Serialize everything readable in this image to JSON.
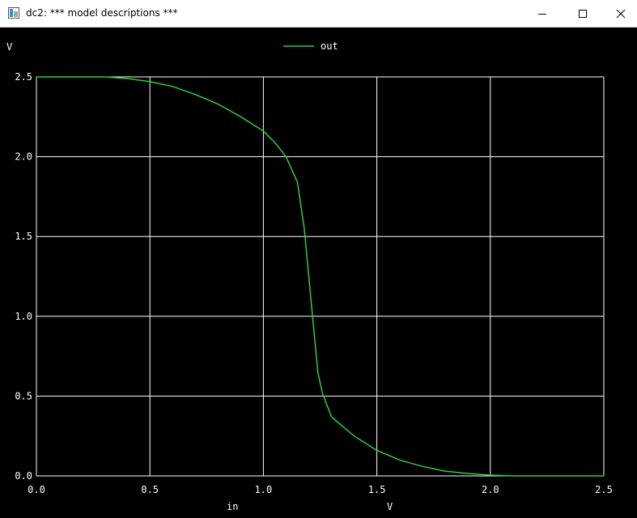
{
  "window": {
    "title": "dc2: *** model descriptions ***",
    "icons": {
      "app": "plot-window-icon",
      "minimize": "minimize-icon",
      "maximize": "maximize-icon",
      "close": "close-icon"
    }
  },
  "chart_data": {
    "type": "line",
    "title": "",
    "xlabel": "in",
    "xunit": "V",
    "ylabel": "",
    "yunit": "V",
    "xlim": [
      0,
      2.5
    ],
    "ylim": [
      0,
      2.5
    ],
    "xticks": [
      "0.0",
      "0.5",
      "1.0",
      "1.5",
      "2.0",
      "2.5"
    ],
    "yticks": [
      "0.0",
      "0.5",
      "1.0",
      "1.5",
      "2.0",
      "2.5"
    ],
    "grid": true,
    "legend": "top-center",
    "background": "#000000",
    "grid_color": "#ffffff",
    "series": [
      {
        "name": "out",
        "color": "#2ecc40",
        "x": [
          0.0,
          0.3,
          0.4,
          0.5,
          0.6,
          0.7,
          0.8,
          0.9,
          1.0,
          1.05,
          1.1,
          1.15,
          1.18,
          1.2,
          1.22,
          1.24,
          1.26,
          1.3,
          1.35,
          1.4,
          1.5,
          1.6,
          1.7,
          1.8,
          1.9,
          2.0,
          2.1,
          2.2,
          2.3,
          2.4,
          2.5
        ],
        "y": [
          2.5,
          2.5,
          2.49,
          2.47,
          2.44,
          2.39,
          2.33,
          2.25,
          2.16,
          2.09,
          2.0,
          1.84,
          1.55,
          1.25,
          0.95,
          0.65,
          0.52,
          0.37,
          0.31,
          0.25,
          0.16,
          0.1,
          0.06,
          0.03,
          0.015,
          0.005,
          0.0,
          0.0,
          0.0,
          0.0,
          0.0
        ]
      }
    ]
  }
}
